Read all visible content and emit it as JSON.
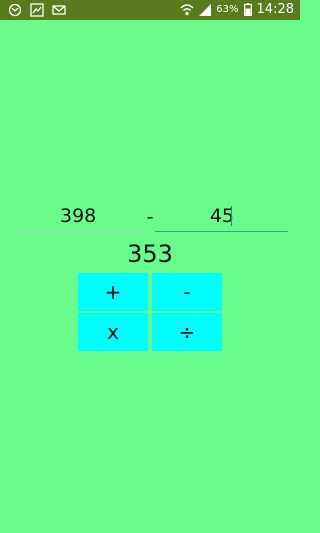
{
  "status_bar": {
    "battery": "63%",
    "time": "14:28",
    "icons": [
      "sync-icon",
      "chart-icon",
      "mail-icon",
      "wifi-icon",
      "signal-icon",
      "battery-icon"
    ]
  },
  "calculator": {
    "operand_a": "398",
    "operator": "-",
    "operand_b": "45",
    "result": "353",
    "buttons": {
      "add": "+",
      "subtract": "-",
      "multiply": "x",
      "divide": "÷"
    }
  },
  "colors": {
    "background": "#69fb8c",
    "status_bar": "#5a7a1e",
    "button": "#00fcfd",
    "active_underline": "#2aa39e"
  }
}
